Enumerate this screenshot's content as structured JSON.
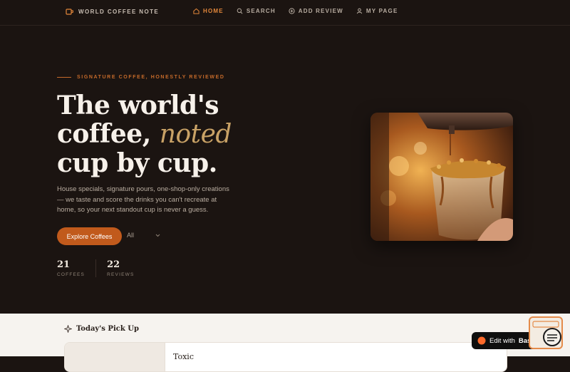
{
  "nav": {
    "brand": "WORLD COFFEE NOTE",
    "items": [
      {
        "label": "HOME",
        "icon": "home-icon",
        "active": true
      },
      {
        "label": "SEARCH",
        "icon": "search-icon",
        "active": false
      },
      {
        "label": "ADD REVIEW",
        "icon": "plus-circle-icon",
        "active": false
      },
      {
        "label": "MY PAGE",
        "icon": "user-icon",
        "active": false
      }
    ]
  },
  "hero": {
    "eyebrow": "SIGNATURE COFFEE, HONESTLY REVIEWED",
    "headline_1": "The world's",
    "headline_2a": "coffee, ",
    "headline_2b": "noted",
    "headline_3": "cup by cup.",
    "description": "House specials, signature pours, one-shop-only creations — we taste and score the drinks you can't recreate at home, so your next standout cup is never a guess.",
    "cta": "Explore Coffees",
    "filter": "All",
    "stats": [
      {
        "value": "21",
        "label": "COFFEES"
      },
      {
        "value": "22",
        "label": "REVIEWS"
      }
    ]
  },
  "pickup": {
    "title": "Today's Pick Up",
    "card_title": "Toxic"
  },
  "badge": {
    "prefix": "Edit with",
    "brand": "Base44"
  },
  "colors": {
    "background": "#1b1411",
    "accent": "#c15a1c",
    "active_nav": "#e3873b",
    "headline_accent": "#c9a266"
  }
}
